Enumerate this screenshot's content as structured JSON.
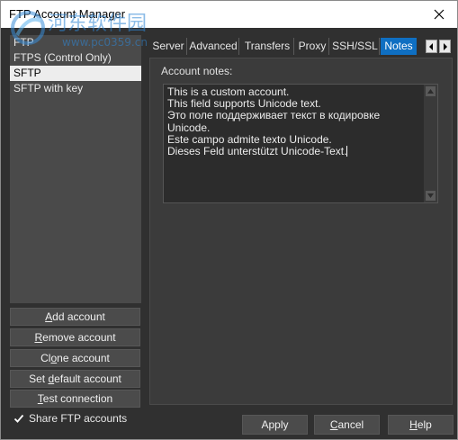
{
  "window": {
    "title": "FTP Account Manager"
  },
  "accounts": {
    "items": [
      "FTP",
      "FTPS (Control Only)",
      "SFTP",
      "SFTP with key"
    ],
    "selected_index": 2
  },
  "side_buttons": [
    {
      "pre": "",
      "u": "A",
      "post": "dd account"
    },
    {
      "pre": "",
      "u": "R",
      "post": "emove account"
    },
    {
      "pre": "Cl",
      "u": "o",
      "post": "ne account"
    },
    {
      "pre": "Set ",
      "u": "d",
      "post": "efault account"
    },
    {
      "pre": "",
      "u": "T",
      "post": "est connection"
    }
  ],
  "share": {
    "label": "Share FTP accounts",
    "checked": true
  },
  "tabs": [
    "Server",
    "Advanced",
    "Transfers",
    "Proxy",
    "SSH/SSL",
    "Notes"
  ],
  "active_tab": "Notes",
  "notes": {
    "label": "Account notes:",
    "text": "This is a custom account.\nThis field supports Unicode text.\nЭто поле поддерживает текст в кодировке Unicode.\nEste campo admite texto Unicode.\nDieses Feld unterstützt Unicode-Text."
  },
  "footer": {
    "apply": "Apply",
    "cancel": {
      "u": "C",
      "post": "ancel"
    },
    "help": {
      "u": "H",
      "post": "elp"
    }
  },
  "watermark": {
    "text": "河东软件园",
    "url": "www.pc0359.cn"
  },
  "colors": {
    "accent": "#0f6fc2",
    "background": "#303030",
    "panel": "#3b3b3b"
  }
}
